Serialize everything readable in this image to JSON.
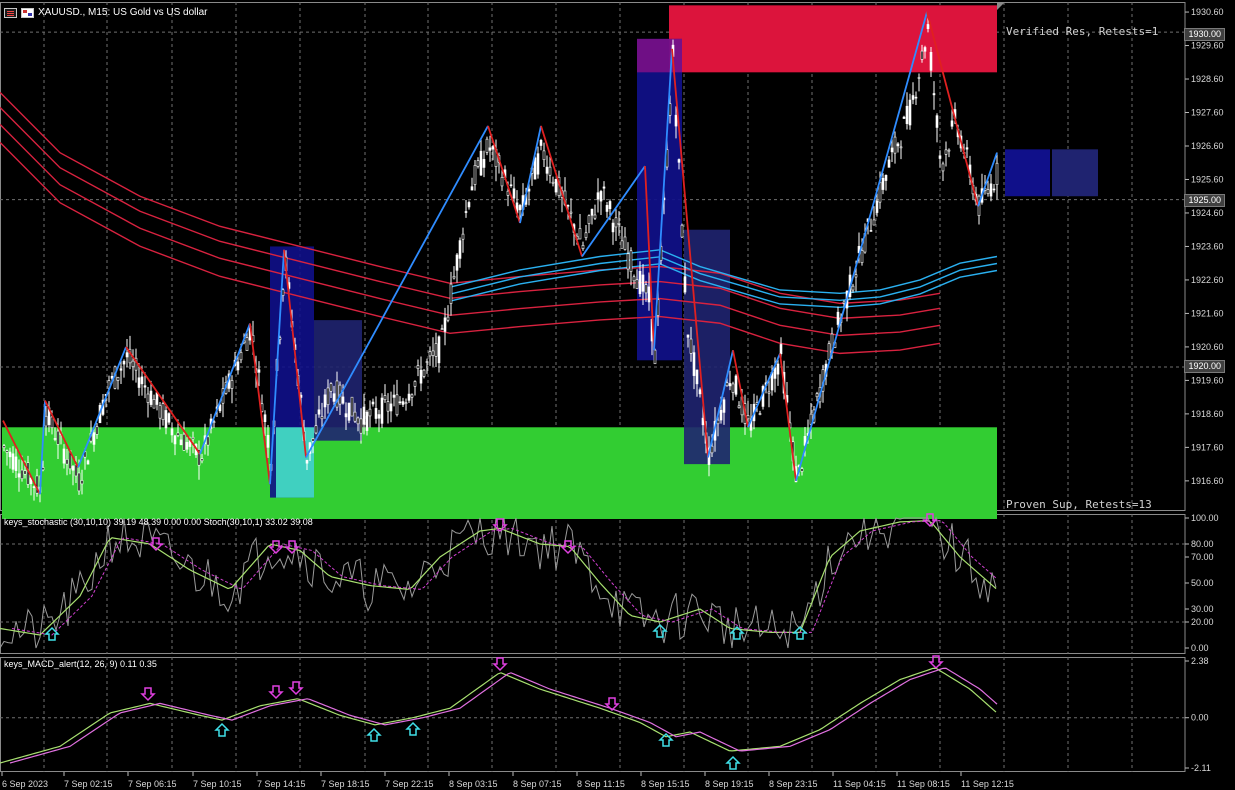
{
  "title": {
    "symbol": "XAUUSD.",
    "timeframe": "M15",
    "description": "US Gold vs US dollar",
    "full": "XAUUSD., M15:  US Gold vs US dollar"
  },
  "colors": {
    "background": "#000000",
    "grid": "#6f6f6f",
    "bull_candle": "#ffffff",
    "bear_candle": "#ffffff",
    "zigzag_up": "#2f8cff",
    "zigzag_down": "#e02020",
    "ema_red": "#d8223f",
    "ema_blue": "#2ab0f0",
    "resistance_zone": "#dc143c",
    "support_zone": "#32cd32",
    "box_blue": "#10108a",
    "box_navy": "#1f2370",
    "stoch_main": "#9a9a9a",
    "stoch_signal": "#a8e070",
    "stoch_dash": "#d040d0",
    "macd_main": "#a8e070",
    "macd_signal": "#e070e0",
    "arrow_down": "#e040e0",
    "arrow_up": "#40e0e8"
  },
  "zones": {
    "resistance_label": "Verified Res, Retests=1",
    "support_label": "Proven Sup, Retests=13",
    "resistance_range": [
      1928.8,
      1930.8
    ],
    "support_range": [
      1915.7,
      1918.2
    ]
  },
  "price_axis": {
    "ticks": [
      "1930.60",
      "1929.60",
      "1928.60",
      "1927.60",
      "1926.60",
      "1925.60",
      "1924.60",
      "1923.60",
      "1922.60",
      "1921.60",
      "1920.60",
      "1919.60",
      "1918.60",
      "1917.60",
      "1916.60"
    ],
    "highlighted": [
      "1930.00",
      "1925.00",
      "1920.00"
    ]
  },
  "stochastic": {
    "label": "keys_stochastic (30,10,10) 39.19 48.39 0.00 0.00 Stoch(30,10,1) 33.02 39.08",
    "ticks": [
      "100.00",
      "80.00",
      "70.00",
      "50.00",
      "30.00",
      "20.00",
      "0.00"
    ]
  },
  "macd": {
    "label": "keys_MACD_alert(12, 26, 9) 0.11 0.35",
    "ticks": [
      "2.38",
      "0.00",
      "-2.11"
    ]
  },
  "time_axis": {
    "labels": [
      "6 Sep 2023",
      "7 Sep 02:15",
      "7 Sep 06:15",
      "7 Sep 10:15",
      "7 Sep 14:15",
      "7 Sep 18:15",
      "7 Sep 22:15",
      "8 Sep 03:15",
      "8 Sep 07:15",
      "8 Sep 11:15",
      "8 Sep 15:15",
      "8 Sep 19:15",
      "8 Sep 23:15",
      "11 Sep 04:15",
      "11 Sep 08:15",
      "11 Sep 12:15"
    ]
  },
  "chart_data": {
    "type": "line",
    "title": "XAUUSD., M15:  US Gold vs US dollar",
    "xlabel": "",
    "ylabel": "",
    "ylim": [
      1915.7,
      1930.9
    ],
    "zigzag": [
      1918.4,
      1916.2,
      1919.0,
      1917.0,
      1920.6,
      1917.4,
      1921.3,
      1916.5,
      1923.5,
      1917.3,
      1927.2,
      1924.3,
      1927.2,
      1923.3,
      1926.0,
      1920.5,
      1929.5,
      1917.3,
      1920.5,
      1918.2,
      1920.4,
      1916.6,
      1930.6,
      1924.8,
      1926.4
    ]
  }
}
